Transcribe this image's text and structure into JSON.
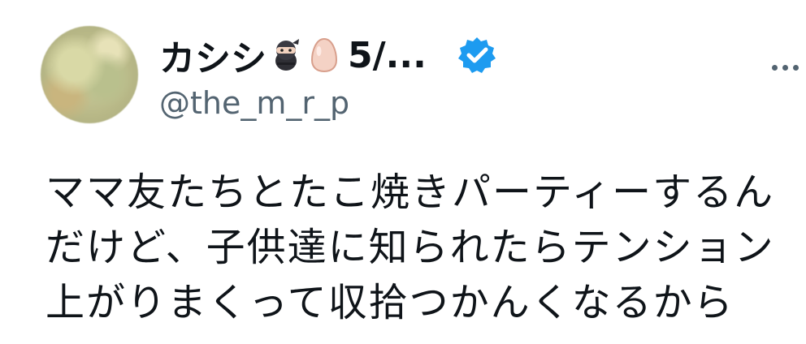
{
  "tweet": {
    "author": {
      "display_name": "カシシ",
      "name_suffix": "5/...",
      "handle": "@the_m_r_p",
      "verified_icon": "verified-badge-icon",
      "emoji_icons": [
        "ninja-icon",
        "egg-icon"
      ]
    },
    "menu_icon": "more-options-icon",
    "text": "ママ友たちとたこ焼きパーティーするんだけど、子供達に知られたらテンション上がりまくって収拾つかんくなるから"
  },
  "colors": {
    "text": "#0f1419",
    "secondary_text": "#536471",
    "verified_blue": "#1d9bf0",
    "background": "#ffffff"
  }
}
